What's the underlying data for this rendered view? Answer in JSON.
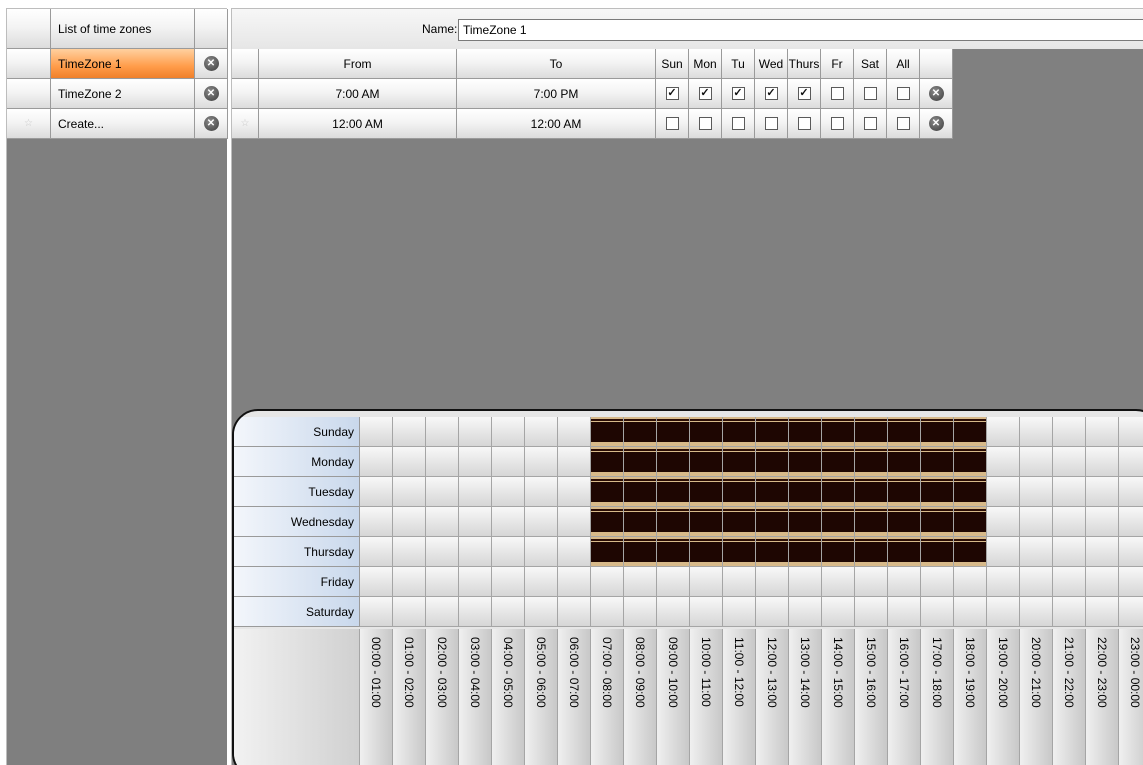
{
  "left_panel": {
    "header": "List of time zones",
    "items": [
      {
        "name": "TimeZone 1",
        "selected": true
      },
      {
        "name": "TimeZone 2",
        "selected": false
      },
      {
        "name": "Create...",
        "selected": false,
        "new_row": true
      }
    ]
  },
  "name_field": {
    "label": "Name:",
    "value": "TimeZone 1"
  },
  "rules_table": {
    "columns": [
      "From",
      "To",
      "Sun",
      "Mon",
      "Tu",
      "Wed",
      "Thurs",
      "Fr",
      "Sat",
      "All"
    ],
    "rows": [
      {
        "from": "7:00 AM",
        "to": "7:00 PM",
        "days": [
          true,
          true,
          true,
          true,
          true,
          false,
          false,
          false
        ]
      },
      {
        "from": "12:00 AM",
        "to": "12:00 AM",
        "days": [
          false,
          false,
          false,
          false,
          false,
          false,
          false,
          false
        ],
        "new_row": true
      }
    ]
  },
  "schedule": {
    "days": [
      "Sunday",
      "Monday",
      "Tuesday",
      "Wednesday",
      "Thursday",
      "Friday",
      "Saturday"
    ],
    "hours": [
      "00:00 - 01:00",
      "01:00 - 02:00",
      "02:00 - 03:00",
      "03:00 - 04:00",
      "04:00 - 05:00",
      "05:00 - 06:00",
      "06:00 - 07:00",
      "07:00 - 08:00",
      "08:00 - 09:00",
      "09:00 - 10:00",
      "10:00 - 11:00",
      "11:00 - 12:00",
      "12:00 - 13:00",
      "13:00 - 14:00",
      "14:00 - 15:00",
      "15:00 - 16:00",
      "16:00 - 17:00",
      "17:00 - 18:00",
      "18:00 - 19:00",
      "19:00 - 20:00",
      "20:00 - 21:00",
      "21:00 - 22:00",
      "22:00 - 23:00",
      "23:00 - 00:00"
    ],
    "active": [
      {
        "day": "Sunday",
        "from_hour": 7,
        "to_hour": 19
      },
      {
        "day": "Monday",
        "from_hour": 7,
        "to_hour": 19
      },
      {
        "day": "Tuesday",
        "from_hour": 7,
        "to_hour": 19
      },
      {
        "day": "Wednesday",
        "from_hour": 7,
        "to_hour": 19
      },
      {
        "day": "Thursday",
        "from_hour": 7,
        "to_hour": 19
      }
    ]
  },
  "icons": {
    "delete": "delete-circle-icon",
    "new_row": "star-icon",
    "checked": "checkmark-icon"
  }
}
